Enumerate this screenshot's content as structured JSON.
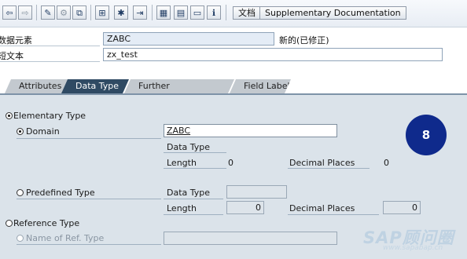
{
  "toolbar": {
    "icons": [
      "back-icon",
      "forward-icon",
      "display-change-icon",
      "activate-icon",
      "check-icon",
      "where-used-icon",
      "hierarchy-icon",
      "navigate-icon",
      "layout-icon",
      "print-icon",
      "window-icon",
      "info-icon"
    ],
    "doc_label": "文档",
    "supp_label": "Supplementary Documentation"
  },
  "header": {
    "data_element_label": "数据元素",
    "data_element_value": "ZABC",
    "status": "新的(已修正)",
    "short_text_label": "短文本",
    "short_text_value": "zx_test"
  },
  "tabs": [
    {
      "label": "Attributes"
    },
    {
      "label": "Data Type"
    },
    {
      "label": "Further Characteristics"
    },
    {
      "label": "Field Label"
    }
  ],
  "panel": {
    "elementary_type": "Elementary Type",
    "domain_label": "Domain",
    "domain_value": "ZABC",
    "data_type_label": "Data Type",
    "length_label": "Length",
    "length_value": "0",
    "decimal_places_label": "Decimal Places",
    "decimal_places_value": "0",
    "predefined_type": "Predefined Type",
    "data_type_label2": "Data Type",
    "length_label2": "Length",
    "length_value2": "0",
    "decimal_places_label2": "Decimal Places",
    "decimal_places_value2": "0",
    "reference_type": "Reference Type",
    "name_ref_type": "Name of Ref. Type"
  },
  "badge": "8",
  "watermark": {
    "brand": "SAP顾问圈",
    "url": "www.sapabap.cn"
  }
}
